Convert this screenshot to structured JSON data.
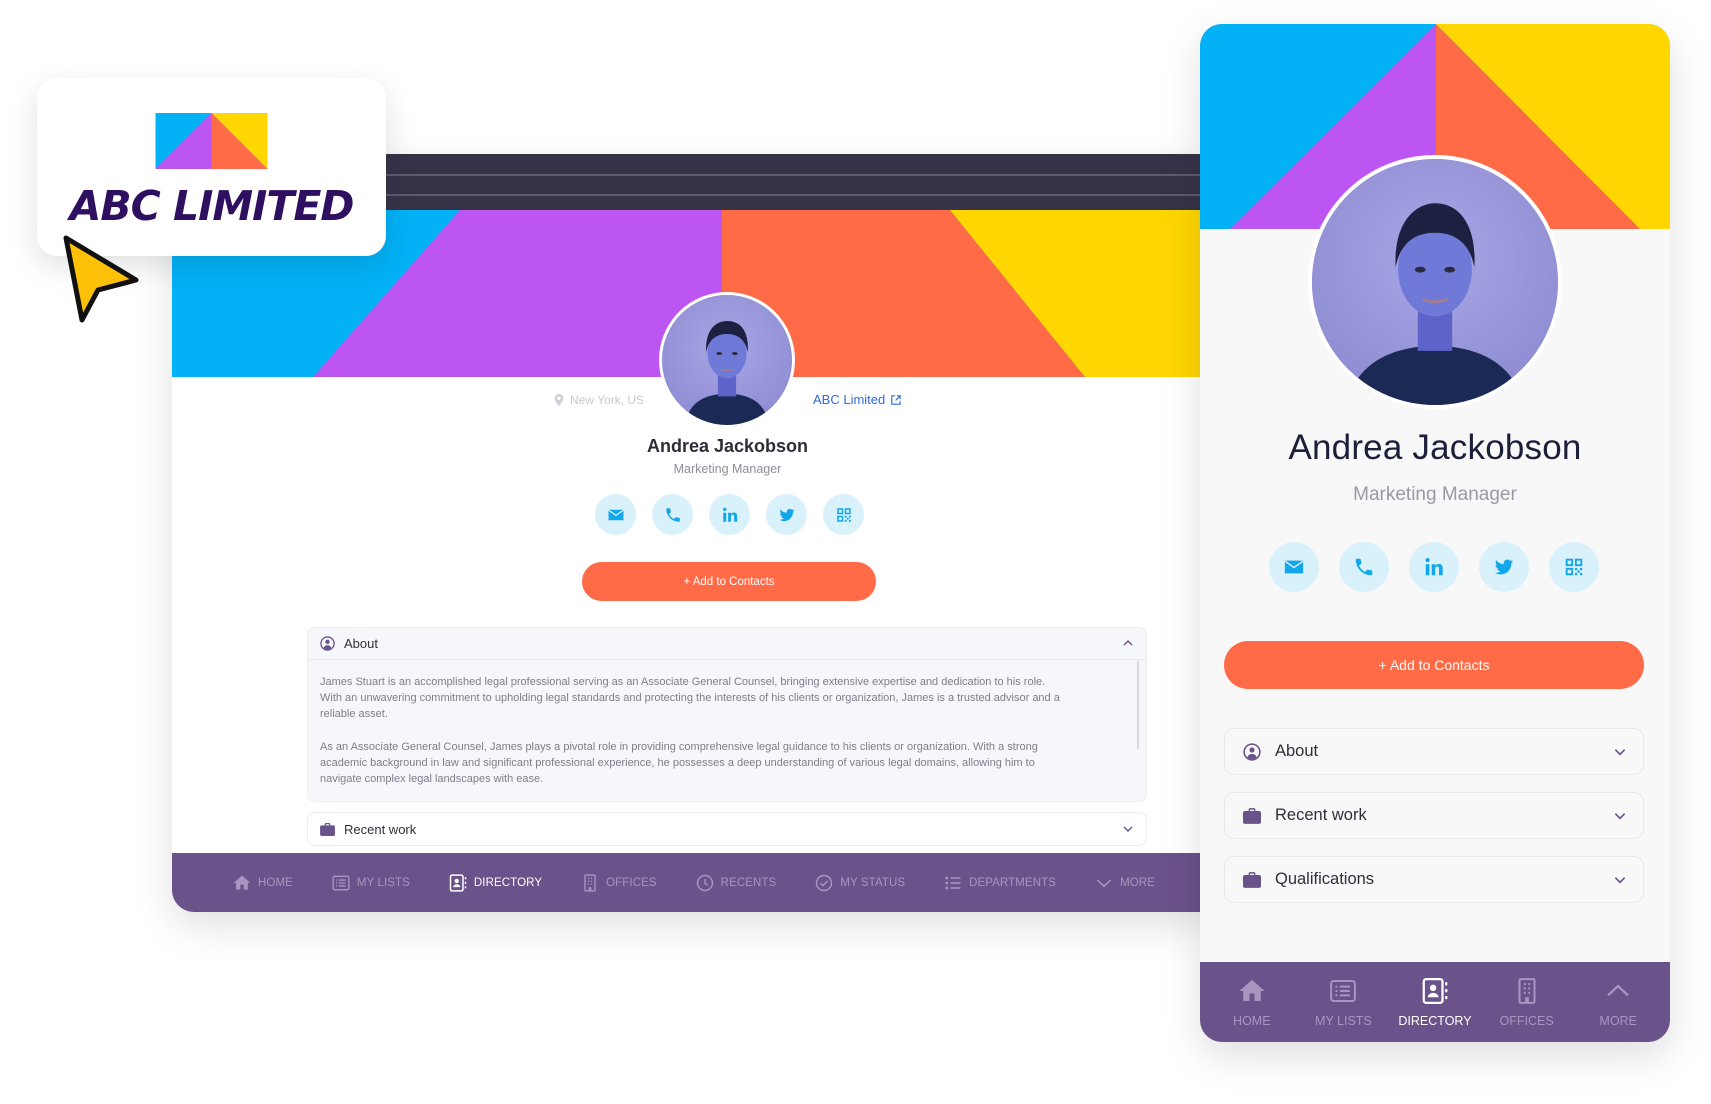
{
  "brand": {
    "name": "ABC LIMITED",
    "colors": {
      "blue": "#03b1f6",
      "purple": "#bd55f2",
      "orange": "#ff6a47",
      "yellow": "#ffd600",
      "navy": "#2f1060",
      "nav_purple": "#6a528a"
    }
  },
  "profile": {
    "name": "Andrea Jackobson",
    "role": "Marketing Manager",
    "location": "New York, US",
    "company_link": "ABC Limited",
    "add_contact_label": "+ Add to Contacts",
    "social": [
      {
        "icon": "email-icon",
        "label": "Email"
      },
      {
        "icon": "phone-icon",
        "label": "Phone"
      },
      {
        "icon": "linkedin-icon",
        "label": "LinkedIn"
      },
      {
        "icon": "twitter-icon",
        "label": "Twitter"
      },
      {
        "icon": "qr-code-icon",
        "label": "QR code"
      }
    ]
  },
  "desktop": {
    "sections": {
      "about": {
        "title": "About",
        "expanded": true,
        "paragraphs": [
          "James Stuart is an accomplished legal professional serving as an Associate General Counsel, bringing extensive expertise and dedication to his role. With an unwavering commitment to upholding legal standards and protecting the interests of his clients or organization, James is a trusted advisor and a reliable asset.",
          "As an Associate General Counsel, James plays a pivotal role in providing comprehensive legal guidance to his clients or organization. With a strong academic background in law and significant professional experience, he possesses a deep understanding of various legal domains, allowing him to navigate complex legal landscapes with ease."
        ]
      },
      "recent_work": {
        "title": "Recent work",
        "expanded": false
      }
    },
    "nav": [
      {
        "label": "HOME",
        "icon": "home-icon",
        "active": false
      },
      {
        "label": "MY LISTS",
        "icon": "list-icon",
        "active": false
      },
      {
        "label": "DIRECTORY",
        "icon": "directory-icon",
        "active": true
      },
      {
        "label": "OFFICES",
        "icon": "building-icon",
        "active": false
      },
      {
        "label": "RECENTS",
        "icon": "clock-icon",
        "active": false
      },
      {
        "label": "MY STATUS",
        "icon": "check-circle-icon",
        "active": false
      },
      {
        "label": "DEPARTMENTS",
        "icon": "departments-icon",
        "active": false
      },
      {
        "label": "MORE",
        "icon": "chevron-down-icon",
        "active": false
      }
    ]
  },
  "mobile": {
    "sections": [
      {
        "title": "About",
        "icon": "user-circle-icon",
        "expanded": false
      },
      {
        "title": "Recent work",
        "icon": "briefcase-icon",
        "expanded": false
      },
      {
        "title": "Qualifications",
        "icon": "briefcase-icon",
        "expanded": false
      }
    ],
    "nav": [
      {
        "label": "HOME",
        "icon": "home-icon",
        "active": false
      },
      {
        "label": "MY LISTS",
        "icon": "list-icon",
        "active": false
      },
      {
        "label": "DIRECTORY",
        "icon": "directory-icon",
        "active": true
      },
      {
        "label": "OFFICES",
        "icon": "building-icon",
        "active": false
      },
      {
        "label": "MORE",
        "icon": "chevron-up-icon",
        "active": false
      }
    ]
  }
}
